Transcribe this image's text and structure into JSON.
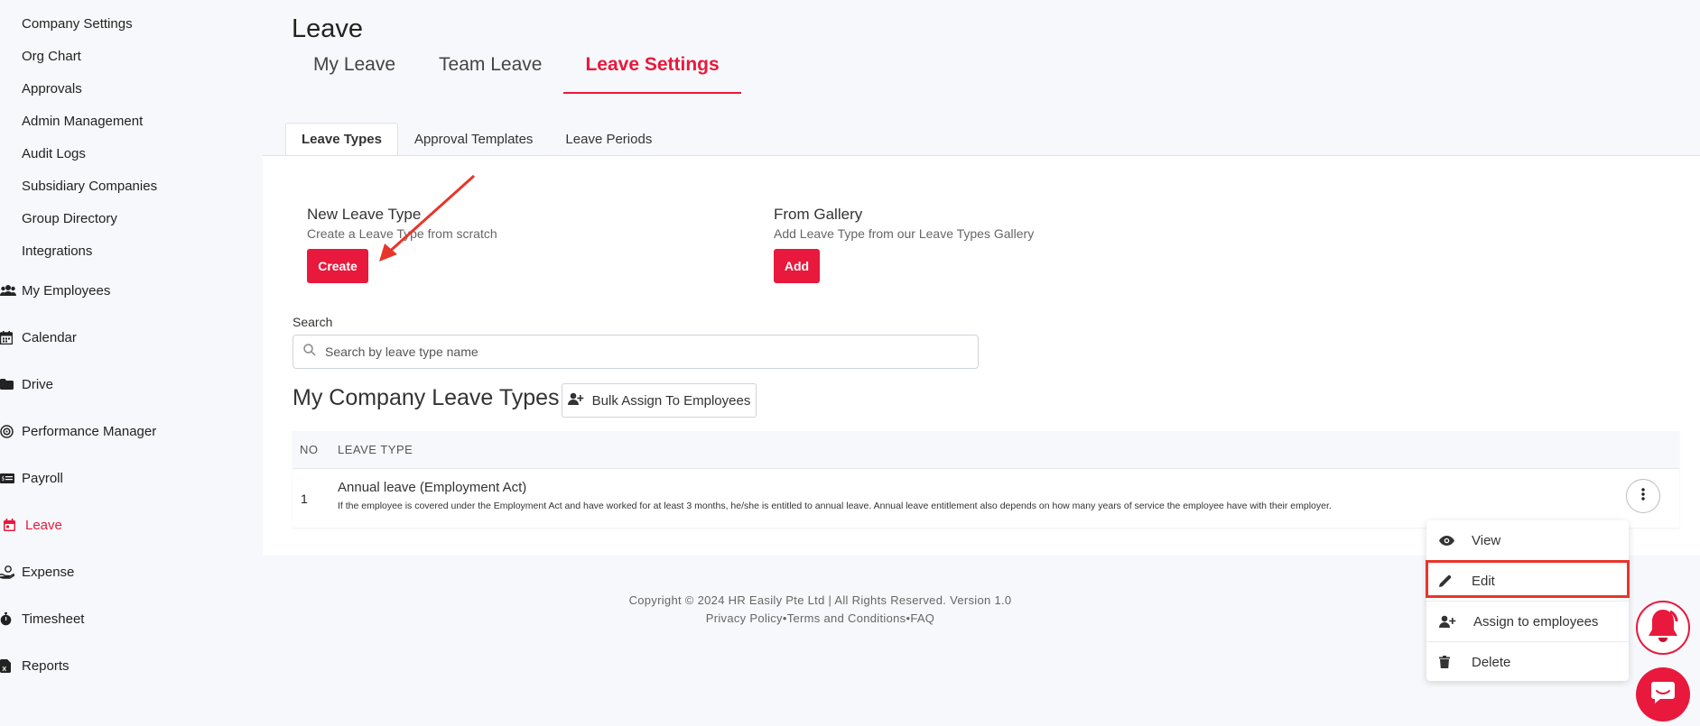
{
  "sidebar": {
    "sub_items": [
      {
        "label": "Company Settings"
      },
      {
        "label": "Org Chart"
      },
      {
        "label": "Approvals"
      },
      {
        "label": "Admin Management"
      },
      {
        "label": "Audit Logs"
      },
      {
        "label": "Subsidiary Companies"
      },
      {
        "label": "Group Directory"
      },
      {
        "label": "Integrations"
      }
    ],
    "nav_items": [
      {
        "label": "My Employees",
        "icon": "users-icon"
      },
      {
        "label": "Calendar",
        "icon": "calendar-icon"
      },
      {
        "label": "Drive",
        "icon": "folder-icon"
      },
      {
        "label": "Performance Manager",
        "icon": "target-icon"
      },
      {
        "label": "Payroll",
        "icon": "money-icon"
      },
      {
        "label": "Leave",
        "icon": "calendar-leave-icon",
        "active": true
      },
      {
        "label": "Expense",
        "icon": "hand-coin-icon"
      },
      {
        "label": "Timesheet",
        "icon": "stopwatch-icon"
      },
      {
        "label": "Reports",
        "icon": "report-icon"
      }
    ]
  },
  "header": {
    "title": "Leave",
    "tabs": [
      {
        "label": "My Leave"
      },
      {
        "label": "Team Leave"
      },
      {
        "label": "Leave Settings",
        "active": true
      }
    ]
  },
  "sub_tabs": [
    {
      "label": "Leave Types",
      "active": true
    },
    {
      "label": "Approval Templates"
    },
    {
      "label": "Leave Periods"
    }
  ],
  "new_leave_type": {
    "title": "New Leave Type",
    "description": "Create a Leave Type from scratch",
    "button": "Create"
  },
  "from_gallery": {
    "title": "From Gallery",
    "description": "Add Leave Type from our Leave Types Gallery",
    "button": "Add"
  },
  "search": {
    "label": "Search",
    "placeholder": "Search by leave type name"
  },
  "leave_types_section": {
    "title": "My Company Leave Types",
    "bulk_button": "Bulk Assign To Employees"
  },
  "table": {
    "headers": [
      "NO",
      "LEAVE TYPE"
    ],
    "rows": [
      {
        "no": "1",
        "name": "Annual leave (Employment Act)",
        "description": "If the employee is covered under the Employment Act and have worked for at least 3 months, he/she is entitled to annual leave. Annual leave entitlement also depends on how many years of service the employee have with their employer."
      }
    ]
  },
  "footer": {
    "copyright": "Copyright © 2024 HR Easily Pte Ltd | All Rights Reserved. Version 1.0",
    "links": [
      "Privacy Policy",
      "Terms and Conditions",
      "FAQ"
    ],
    "separator": "•"
  },
  "row_menu": {
    "items": [
      {
        "label": "View",
        "icon": "eye-icon"
      },
      {
        "label": "Edit",
        "icon": "pencil-icon"
      },
      {
        "label": "Assign to employees",
        "icon": "user-plus-icon"
      },
      {
        "label": "Delete",
        "icon": "trash-icon"
      }
    ]
  },
  "colors": {
    "accent": "#e8193c",
    "annotation": "#e8352a"
  }
}
